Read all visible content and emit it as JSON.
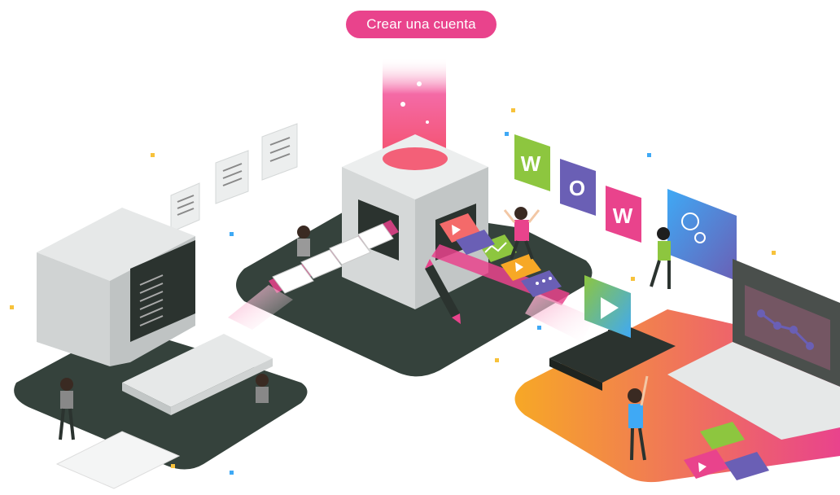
{
  "cta": {
    "label": "Crear una cuenta",
    "color": "#e9438c"
  },
  "wow_tiles": [
    {
      "letter": "W",
      "color": "#8dc63f"
    },
    {
      "letter": "O",
      "color": "#6a5fb5"
    },
    {
      "letter": "W",
      "color": "#e9438c"
    }
  ],
  "colors": {
    "accent": "#e9438c",
    "platform_dark": "#35423c",
    "platform_gradient_start": "#f7a826",
    "platform_gradient_end": "#e9438c",
    "video_tile": "#8dc63f",
    "purple": "#6a5fb5",
    "blue": "#3fa9f5"
  },
  "icons": [
    "document-icon",
    "play-icon",
    "image-icon",
    "graph-icon",
    "pencil-icon",
    "phone-icon",
    "laptop-icon",
    "computer-icon"
  ]
}
